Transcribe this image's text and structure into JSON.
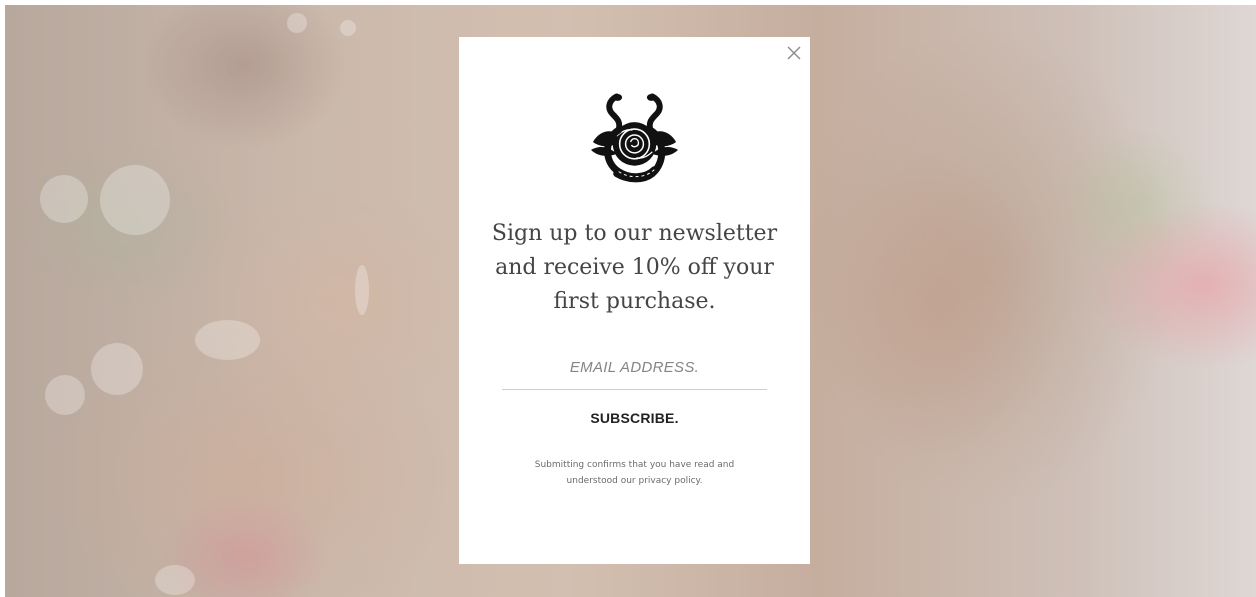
{
  "background": {
    "description_icon": "photo-background",
    "tint": "#ffffff"
  },
  "modal": {
    "close_icon": "close-icon",
    "logo_icon": "snakes-rose-logo-icon",
    "headline": "Sign up to our newsletter and receive 10% off your first purchase.",
    "email_placeholder": "EMAIL ADDRESS.",
    "email_value": "",
    "subscribe_label": "SUBSCRIBE.",
    "legal_text": "Submitting confirms that you have read and understood our privacy policy."
  }
}
